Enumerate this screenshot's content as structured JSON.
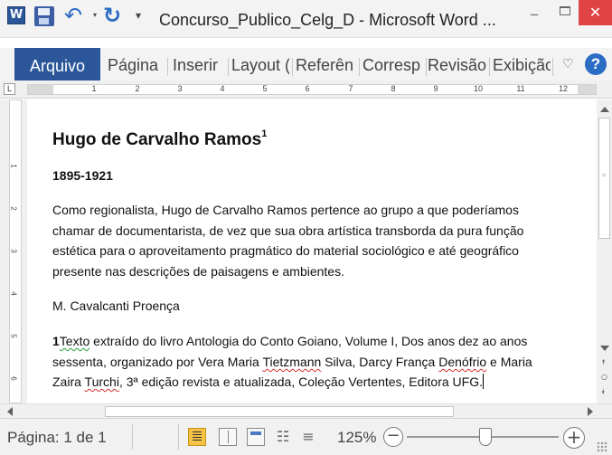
{
  "titlebar": {
    "app_logo": "W",
    "title": "Concurso_Publico_Celg_D  -  Microsoft Word ...",
    "icons": [
      "word-logo",
      "save-icon",
      "undo-icon",
      "redo-icon",
      "customize-qat-icon",
      "minimize-icon",
      "maximize-icon",
      "close-icon"
    ]
  },
  "ribbon": {
    "file_tab": "Arquivo",
    "tabs": [
      "Página",
      "Inserir",
      "Layout (",
      "Referên",
      "Corresp",
      "Revisão",
      "Exibição"
    ],
    "accent_color": "#2b579a"
  },
  "ruler": {
    "tab_selector": "L",
    "numbers": [
      "1",
      "2",
      "3",
      "4",
      "5",
      "6",
      "7",
      "8",
      "9",
      "10",
      "11",
      "12"
    ],
    "vertical_numbers": [
      "1",
      "2",
      "3",
      "4",
      "5",
      "6"
    ]
  },
  "document": {
    "heading": "Hugo de Carvalho Ramos",
    "heading_footnote": "1",
    "dates": "1895-1921",
    "paragraph_lines": [
      "Como regionalista, Hugo de Carvalho Ramos pertence ao grupo a que poderíamos",
      "chamar de documentarista, de vez que sua obra artística transborda da pura função",
      "estética para o aproveitamento pragmático do material sociológico e até geográfico",
      "presente nas descrições de paisagens e ambientes."
    ],
    "author": "M. Cavalcanti Proença",
    "footnote": {
      "marker": "1",
      "line1_word": "Texto",
      "line1_rest": " extraído do livro Antologia do Conto Goiano, Volume I, Dos anos dez ao anos",
      "line2_a": "sessenta, organizado por Vera Maria ",
      "line2_b": "Tietzmann",
      "line2_c": " Silva, Darcy França ",
      "line2_d": "Denófrio",
      "line2_e": " e Maria",
      "line3_a": "Zaira ",
      "line3_b": "Turchi",
      "line3_c": ", 3ª edição revista e atualizada, Coleção Vertentes, Editora UFG."
    }
  },
  "statusbar": {
    "page": "Página: 1 de 1",
    "zoom": "125%",
    "zoom_minus": "−",
    "zoom_plus": "+",
    "zoom_fraction": 0.52
  }
}
